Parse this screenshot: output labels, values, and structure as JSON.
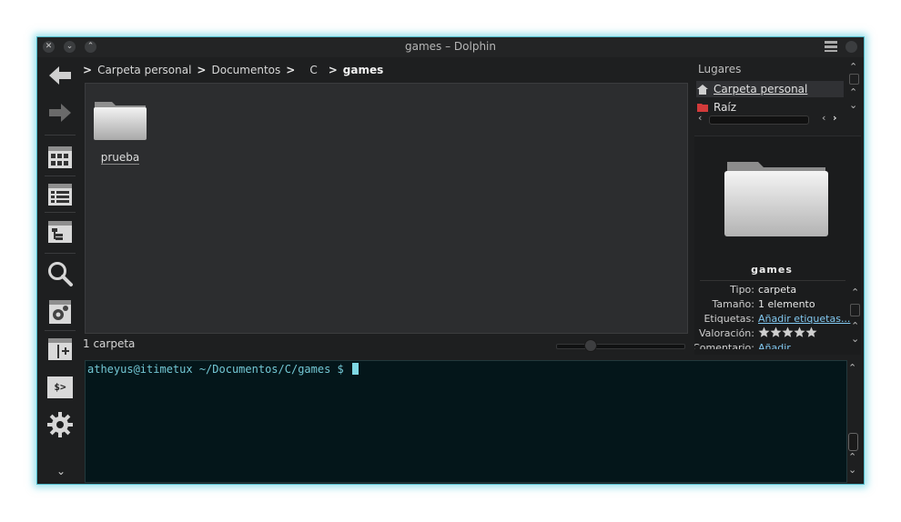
{
  "window": {
    "title": "games – Dolphin",
    "accent": "#4fb9c9",
    "close": "✕",
    "minimize": "⌄",
    "maximize": "⌃"
  },
  "breadcrumb": {
    "items": [
      "Carpeta personal",
      "Documentos",
      "C",
      "games"
    ],
    "separator": ">"
  },
  "toolbar": {
    "icons": [
      "back-arrow-icon",
      "forward-arrow-icon",
      "icons-view-icon",
      "details-view-icon",
      "tree-view-icon",
      "search-icon",
      "settings-panel-icon",
      "split-view-icon",
      "terminal-icon",
      "gear-icon"
    ],
    "terminal_label": "$>",
    "more_label": "⌄"
  },
  "files": [
    {
      "name": "prueba",
      "type": "folder"
    }
  ],
  "status": {
    "text": "1 carpeta"
  },
  "places": {
    "title": "Lugares",
    "items": [
      {
        "label": "Carpeta personal",
        "icon": "home-icon"
      },
      {
        "label": "Raíz",
        "icon": "root-folder-icon"
      }
    ]
  },
  "info": {
    "name": "games",
    "rows": [
      {
        "label": "Tipo:",
        "value": "carpeta"
      },
      {
        "label": "Tamaño:",
        "value": "1 elemento"
      },
      {
        "label": "Etiquetas:",
        "value": "Añadir etiquetas..."
      },
      {
        "label": "Valoración:",
        "value": ""
      },
      {
        "label": "Comentario:",
        "value": "Añadir"
      }
    ],
    "rating_stars": 5
  },
  "terminal": {
    "prompt": "atheyus@itimetux ~/Documentos/C/games $ "
  }
}
